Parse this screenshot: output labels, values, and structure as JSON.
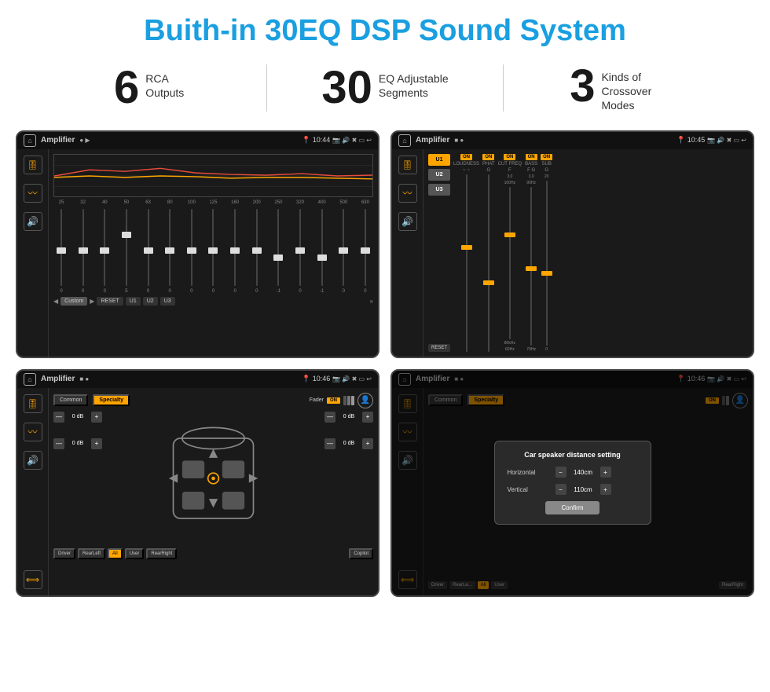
{
  "page": {
    "title": "Buith-in 30EQ DSP Sound System"
  },
  "stats": [
    {
      "number": "6",
      "label": "RCA\nOutputs"
    },
    {
      "number": "30",
      "label": "EQ Adjustable\nSegments"
    },
    {
      "number": "3",
      "label": "Kinds of\nCrossover Modes"
    }
  ],
  "screens": [
    {
      "id": "eq-screen",
      "statusBar": {
        "title": "Amplifier",
        "time": "10:44"
      },
      "type": "eq"
    },
    {
      "id": "crossover-screen",
      "statusBar": {
        "title": "Amplifier",
        "time": "10:45"
      },
      "type": "crossover"
    },
    {
      "id": "fader-screen",
      "statusBar": {
        "title": "Amplifier",
        "time": "10:46"
      },
      "type": "fader"
    },
    {
      "id": "distance-screen",
      "statusBar": {
        "title": "Amplifier",
        "time": "10:46"
      },
      "type": "distance-dialog"
    }
  ],
  "eq": {
    "frequencies": [
      "25",
      "32",
      "40",
      "50",
      "63",
      "80",
      "100",
      "125",
      "160",
      "200",
      "250",
      "320",
      "400",
      "500",
      "630"
    ],
    "sliderValues": [
      "0",
      "0",
      "0",
      "5",
      "0",
      "0",
      "0",
      "0",
      "0",
      "0",
      "-1",
      "0",
      "-1"
    ],
    "buttons": [
      "Custom",
      "RESET",
      "U1",
      "U2",
      "U3"
    ]
  },
  "crossover": {
    "presets": [
      "U1",
      "U2",
      "U3"
    ],
    "controls": [
      "LOUDNESS",
      "PHAT",
      "CUT FREQ",
      "BASS",
      "SUB"
    ],
    "states": [
      "ON",
      "ON",
      "ON",
      "ON",
      "ON"
    ]
  },
  "fader": {
    "tabs": [
      "Common",
      "Specialty"
    ],
    "activeTab": "Specialty",
    "faderLabel": "Fader",
    "dbValues": [
      "0 dB",
      "0 dB",
      "0 dB",
      "0 dB"
    ],
    "bottomButtons": [
      "Driver",
      "RearLeft",
      "All",
      "User",
      "RearRight",
      "Copilot"
    ]
  },
  "dialog": {
    "title": "Car speaker distance setting",
    "fields": [
      {
        "label": "Horizontal",
        "value": "140cm"
      },
      {
        "label": "Vertical",
        "value": "110cm"
      }
    ],
    "confirmLabel": "Confirm"
  }
}
